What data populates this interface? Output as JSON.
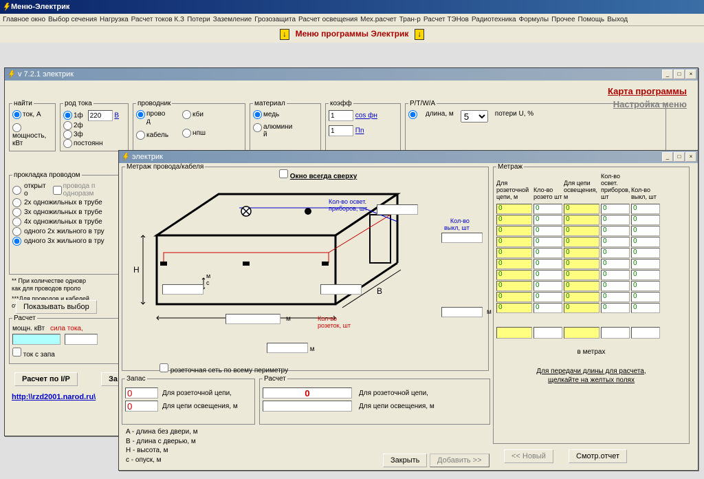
{
  "main_title": "Меню-Электрик",
  "menu_items": [
    "Главное окно",
    "Выбор сечения",
    "Нагрузка",
    "Расчет токов К.З",
    "Потери",
    "Заземление",
    "Грозозащита",
    "Расчет освещения",
    "Мех.расчет",
    "Тран-р",
    "Расчет ТЭНов",
    "Радиотехника",
    "Формулы",
    "Прочее",
    "Помощь",
    "Выход"
  ],
  "banner_text": "Меню программы Электрик",
  "win1": {
    "title": "v 7.2.1 электрик",
    "link1": "Карта программы",
    "link2": "Настройка меню",
    "find": {
      "legend": "найти",
      "opt1": "ток, А",
      "opt2": "мощность, кВт"
    },
    "rod": {
      "legend": "род тока",
      "opt1": "1ф",
      "opt2": "2ф",
      "opt3": "3ф",
      "opt4": "постоянн",
      "voltage": "220",
      "v_label": "В"
    },
    "provodnik": {
      "legend": "проводник",
      "opt1": "прово\nд",
      "opt2": "кабель",
      "opt3": "кби",
      "opt4": "нпш"
    },
    "material": {
      "legend": "материал",
      "opt1": "медь",
      "opt2": "алюмини\nй"
    },
    "koef": {
      "legend": "коэфф",
      "cos": "cos фн",
      "n": "Пn",
      "val1": "1",
      "val2": "1"
    },
    "ptwa": {
      "legend": "P/T/W/A",
      "dlina": "длина, м",
      "dlina_val": "5",
      "poteri": "потери U, %"
    },
    "prokladka": {
      "legend": "прокладка проводом",
      "l0": "открыт\nо",
      "l0b": "провода п\nодноразм",
      "l1": "2х одножильных в трубе",
      "l2": "3х одножильных в трубе",
      "l3": "4х одножильных в трубе",
      "l4": "одного 2х жильного в тру",
      "l5": "одного 3х жильного в тру"
    },
    "notes": {
      "n1": "** При количестве одновр\nкак для   проводов проло",
      "n2": "***Для проводов и кабелей\nоткрыто   (в воздухе) с по"
    },
    "btn_show": "Показывать выбор",
    "raschet": {
      "legend": "Расчет",
      "lbl1": "мощн. кВт",
      "lbl2": "сила тока,",
      "chk": "ток с запа"
    },
    "btn_rp": "Расчет по I/P",
    "btn_za": "За",
    "url": "http:\\\\rzd2001.narod.ru\\"
  },
  "win2": {
    "title": "электрик",
    "fs1_legend": "Метраж провода/кабеля",
    "chk_top": "Окно всегда сверху",
    "diag": {
      "kol_oswet": "Кол-во освет.\nприборов, шт",
      "kol_vykl": "Кол-во\nвыкл, шт",
      "kol_rozetok": "Кол-во\nрозеток, шт",
      "H": "H",
      "B": "B",
      "m1": "м",
      "m2": "м",
      "m3": "м",
      "mc": "м\nс"
    },
    "perimeter": "розеточная сеть по всему периметру",
    "zapas": {
      "legend": "Запас",
      "v1": "0",
      "t1": "Для розеточной цепи,",
      "v2": "0",
      "t2": "Для цепи освещения, м"
    },
    "raschet": {
      "legend": "Расчет",
      "v1": "0",
      "t1": "Для розеточной цепи,",
      "v2": "",
      "t2": "Для цепи освещения, м"
    },
    "letters": {
      "a": "A - длина без двери, м",
      "b": "B - длина с дверью, м",
      "h": "H - высота, м",
      "c": "c - опуск, м"
    },
    "btn_close": "Закрыть",
    "btn_add": "Добавить >>",
    "metraj2": {
      "legend": "Метраж",
      "hdr": [
        "Для розеточной цепи, м",
        "Кло-во розето шт",
        "Для цепи освещения, м",
        "Кол-во освет. приборов, шт",
        "Кол-во выкл, шт"
      ],
      "rows": 10,
      "note": "в метрах",
      "link": "Для передачи длины для расчета,\nщелкайте на желтых полях",
      "btn_new": "<< Новый",
      "btn_view": "Смотр.отчет"
    }
  }
}
